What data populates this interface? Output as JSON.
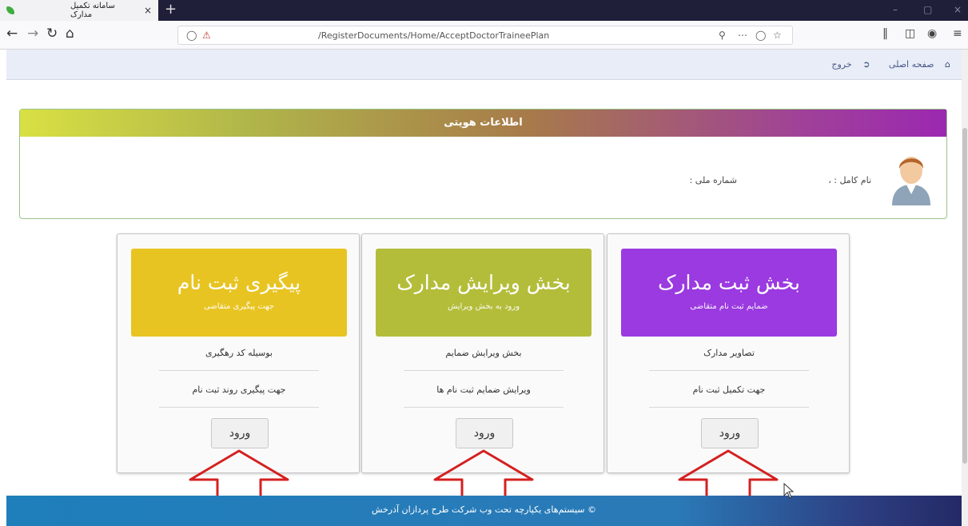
{
  "browser": {
    "tab_title": "سامانه تکمیل مدارک",
    "tab_close": "×",
    "new_tab": "+",
    "url": "/RegisterDocuments/Home/AcceptDoctorTraineePlan",
    "win_min": "–",
    "win_max": "▢",
    "win_close": "×"
  },
  "header": {
    "home_link": "صفحه اصلی",
    "logout_link": "خروج"
  },
  "identity": {
    "panel_title": "اطلاعات هویتی",
    "full_name_label": "نام کامل : ،",
    "national_id_label": "شماره ملی :"
  },
  "cards": [
    {
      "title": "بخش ثبت مدارک",
      "subtitle": "ضمایم ثبت نام متقاضی",
      "line1": "تصاویر مدارک",
      "line2": "جهت تکمیل ثبت نام",
      "button": "ورود",
      "color": "#9a3ae0"
    },
    {
      "title": "بخش ویرایش مدارک",
      "subtitle": "ورود به بخش ویرایش",
      "line1": "بخش ویرایش ضمایم",
      "line2": "ویرایش ضمایم ثبت نام ها",
      "button": "ورود",
      "color": "#b3bd3a"
    },
    {
      "title": "پیگیری ثبت نام",
      "subtitle": "جهت پیگیری متقاضی",
      "line1": "بوسیله کد رهگیری",
      "line2": "جهت پیگیری روند ثبت نام",
      "button": "ورود",
      "color": "#e8c422"
    }
  ],
  "footer": {
    "text": "© سیستم‌های یکپارچه تحت وب شرکت طرح پردازان آذرخش"
  },
  "colors": {
    "arrow": "#d42020",
    "footer": "#1e7fba"
  }
}
